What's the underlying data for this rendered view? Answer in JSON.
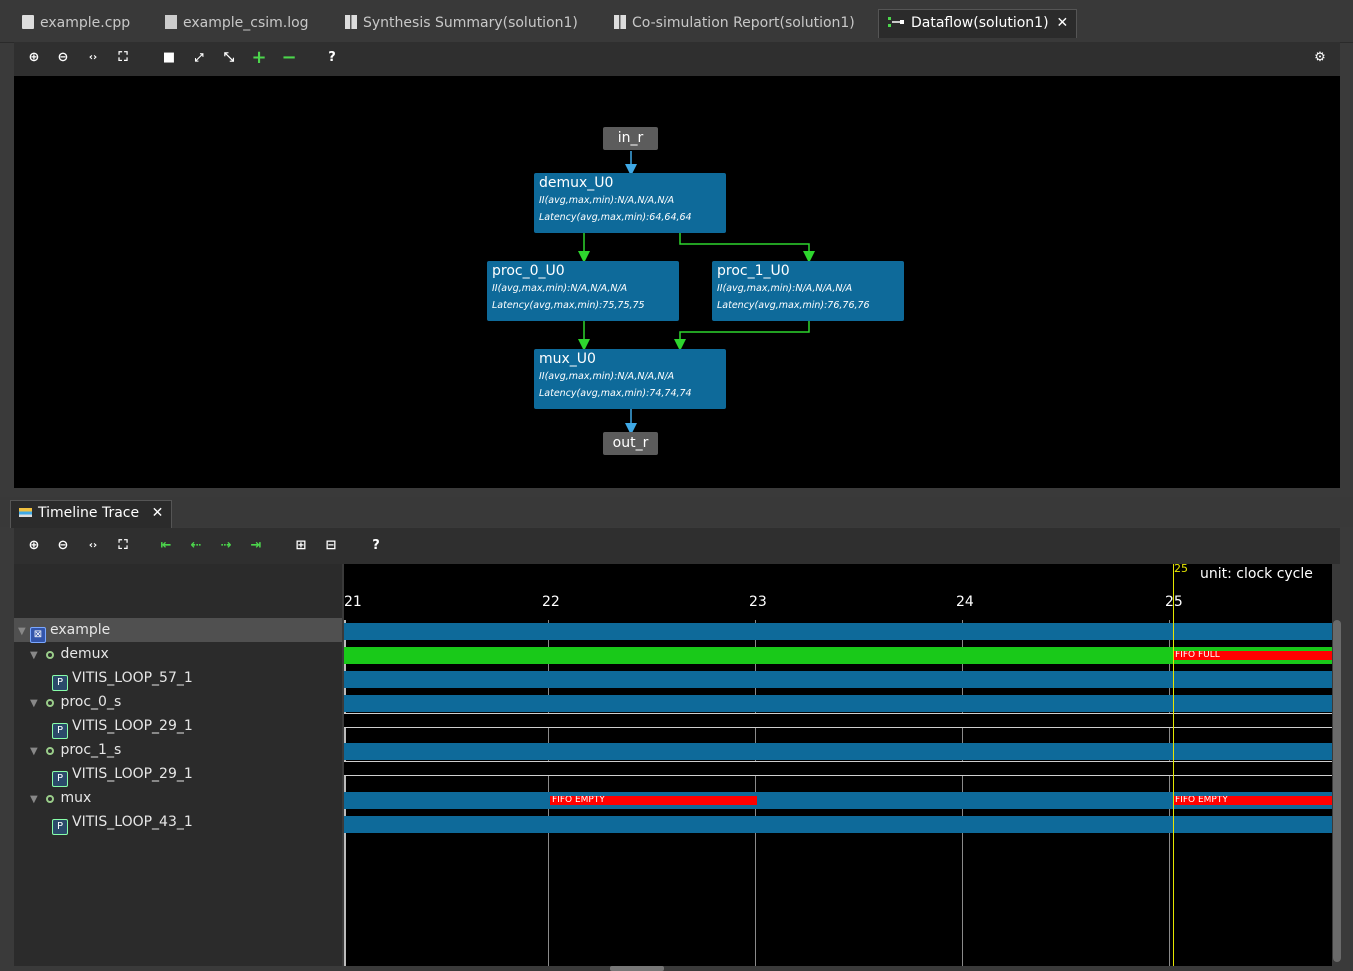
{
  "tabs": [
    {
      "label": "example.cpp"
    },
    {
      "label": "example_csim.log"
    },
    {
      "label": "Synthesis Summary(solution1)"
    },
    {
      "label": "Co-simulation Report(solution1)"
    },
    {
      "label": "Dataflow(solution1)",
      "close": "✕"
    }
  ],
  "dataflow": {
    "in_port": "in_r",
    "out_port": "out_r",
    "nodes": [
      {
        "name": "demux_U0",
        "ii": "II(avg,max,min):N/A,N/A,N/A",
        "latency": "Latency(avg,max,min):64,64,64"
      },
      {
        "name": "proc_0_U0",
        "ii": "II(avg,max,min):N/A,N/A,N/A",
        "latency": "Latency(avg,max,min):75,75,75"
      },
      {
        "name": "proc_1_U0",
        "ii": "II(avg,max,min):N/A,N/A,N/A",
        "latency": "Latency(avg,max,min):76,76,76"
      },
      {
        "name": "mux_U0",
        "ii": "II(avg,max,min):N/A,N/A,N/A",
        "latency": "Latency(avg,max,min):74,74,74"
      }
    ]
  },
  "timeline": {
    "tab_label": "Timeline Trace",
    "tab_close": "✕",
    "unit": "unit: clock cycle",
    "cursor_label": "25",
    "ticks": [
      "21",
      "22",
      "23",
      "24",
      "25"
    ],
    "tree": [
      {
        "label": "example"
      },
      {
        "label": "demux"
      },
      {
        "label": "VITIS_LOOP_57_1"
      },
      {
        "label": "proc_0_s"
      },
      {
        "label": "VITIS_LOOP_29_1"
      },
      {
        "label": "proc_1_s"
      },
      {
        "label": "VITIS_LOOP_29_1"
      },
      {
        "label": "mux"
      },
      {
        "label": "VITIS_LOOP_43_1"
      }
    ],
    "fifo_labels": {
      "full": "FIFO FULL",
      "empty": "FIFO EMPTY"
    }
  },
  "colors": {
    "node": "#0e6a9a",
    "active_bar": "#19c919",
    "fifo": "#ff0000"
  }
}
